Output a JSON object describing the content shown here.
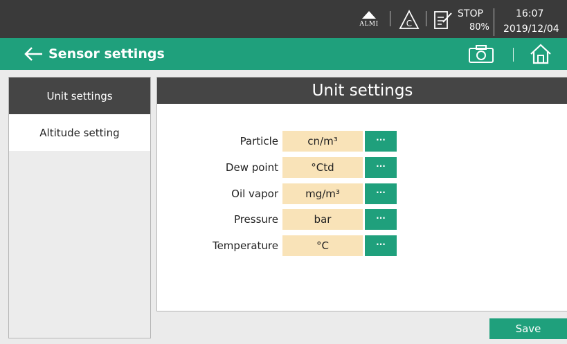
{
  "status_bar": {
    "alarm_label": "ALMI",
    "state": "STOP",
    "battery": "80%",
    "time": "16:07",
    "date": "2019/12/04",
    "icons": [
      "alarm-icon",
      "warning-icon",
      "note-icon"
    ]
  },
  "header": {
    "title": "Sensor settings",
    "icons": [
      "back-arrow-icon",
      "camera-icon",
      "home-icon"
    ],
    "color": "#1fa07c"
  },
  "sidebar": {
    "items": [
      {
        "label": "Unit settings",
        "active": true
      },
      {
        "label": "Altitude setting",
        "active": false
      }
    ]
  },
  "main": {
    "title": "Unit settings",
    "rows": [
      {
        "label": "Particle",
        "value": "cn/m³",
        "button": "···"
      },
      {
        "label": "Dew point",
        "value": "°Ctd",
        "button": "···"
      },
      {
        "label": "Oil vapor",
        "value": "mg/m³",
        "button": "···"
      },
      {
        "label": "Pressure",
        "value": "bar",
        "button": "···"
      },
      {
        "label": "Temperature",
        "value": "°C",
        "button": "···"
      }
    ]
  },
  "footer": {
    "save_label": "Save"
  },
  "colors": {
    "accent": "#1fa07c",
    "dark": "#454545",
    "value_bg": "#f9e3b8"
  }
}
